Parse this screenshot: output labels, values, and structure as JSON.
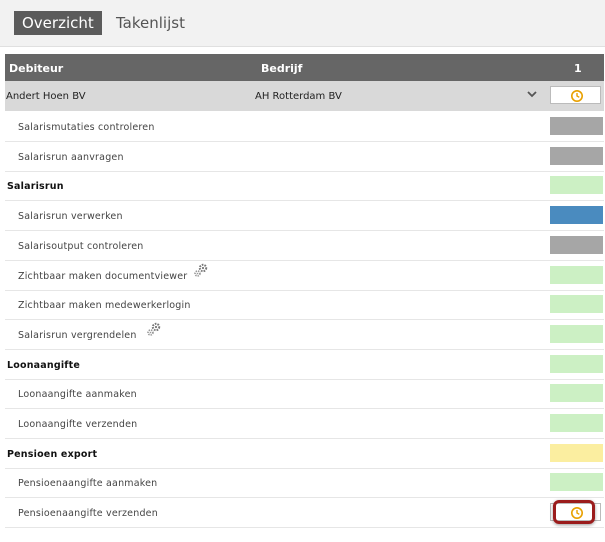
{
  "tabs": {
    "overview": "Overzicht",
    "tasklist": "Takenlijst"
  },
  "table": {
    "col_debtor": "Debiteur",
    "col_company": "Bedrijf",
    "col_period": "1"
  },
  "debtor_row": {
    "debtor": "Andert Hoen BV",
    "company": "AH Rotterdam BV"
  },
  "rows": [
    {
      "label": "Salarismutaties controleren",
      "type": "task",
      "status": "gray"
    },
    {
      "label": "Salarisrun aanvragen",
      "type": "task",
      "status": "gray"
    },
    {
      "label": "Salarisrun",
      "type": "section",
      "status": "green"
    },
    {
      "label": "Salarisrun verwerken",
      "type": "task",
      "status": "blue"
    },
    {
      "label": "Salarisoutput controleren",
      "type": "task",
      "status": "gray"
    },
    {
      "label": "Zichtbaar maken documentviewer",
      "type": "task",
      "status": "green",
      "icon": "gear-icon"
    },
    {
      "label": "Zichtbaar maken medewerkerlogin",
      "type": "task",
      "status": "green"
    },
    {
      "label": "Salarisrun vergrendelen",
      "type": "task",
      "status": "green",
      "icon": "gear-icon"
    },
    {
      "label": "Loonaangifte",
      "type": "section",
      "status": "green"
    },
    {
      "label": "Loonaangifte aanmaken",
      "type": "task",
      "status": "green"
    },
    {
      "label": "Loonaangifte verzenden",
      "type": "task",
      "status": "green"
    },
    {
      "label": "Pensioen export",
      "type": "section",
      "status": "yellow"
    },
    {
      "label": "Pensioenaangifte aanmaken",
      "type": "task",
      "status": "green"
    },
    {
      "label": "Pensioenaangifte verzenden",
      "type": "task",
      "status": "clock",
      "icon": "clock-icon"
    }
  ],
  "colors": {
    "gray": "#a6a6a6",
    "green": "#ccf0c4",
    "blue": "#4a8bbf",
    "yellow": "#fbeea0",
    "clock": "#e8a000",
    "header": "#666666",
    "highlight": "#9b1c1c"
  }
}
